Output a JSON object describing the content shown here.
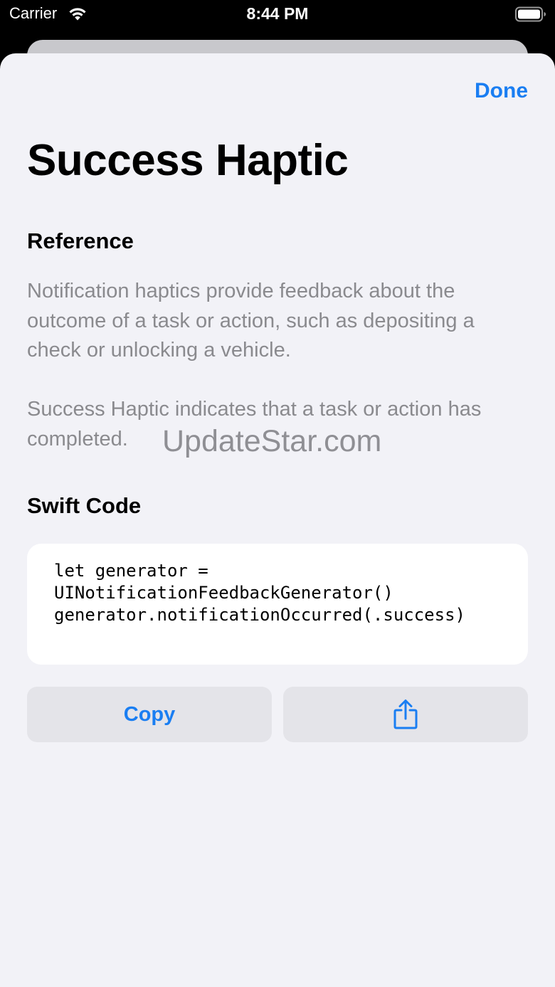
{
  "status_bar": {
    "carrier": "Carrier",
    "time": "8:44 PM"
  },
  "sheet": {
    "done_label": "Done",
    "title": "Success Haptic",
    "reference_heading": "Reference",
    "description_1": "Notification haptics provide feedback about the outcome of a task or action, such as depositing a check or unlocking a vehicle.",
    "description_2": "Success Haptic indicates that a task or action has completed.",
    "swift_heading": "Swift Code",
    "code": "let generator =\nUINotificationFeedbackGenerator()\ngenerator.notificationOccurred(.success)",
    "copy_label": "Copy",
    "share_icon": "share-icon"
  },
  "watermark": "UpdateStar.com",
  "colors": {
    "accent": "#1a7ef2",
    "sheet_background": "#f2f2f7",
    "secondary_text": "#8a8a8e",
    "button_background": "#e4e4e9"
  }
}
